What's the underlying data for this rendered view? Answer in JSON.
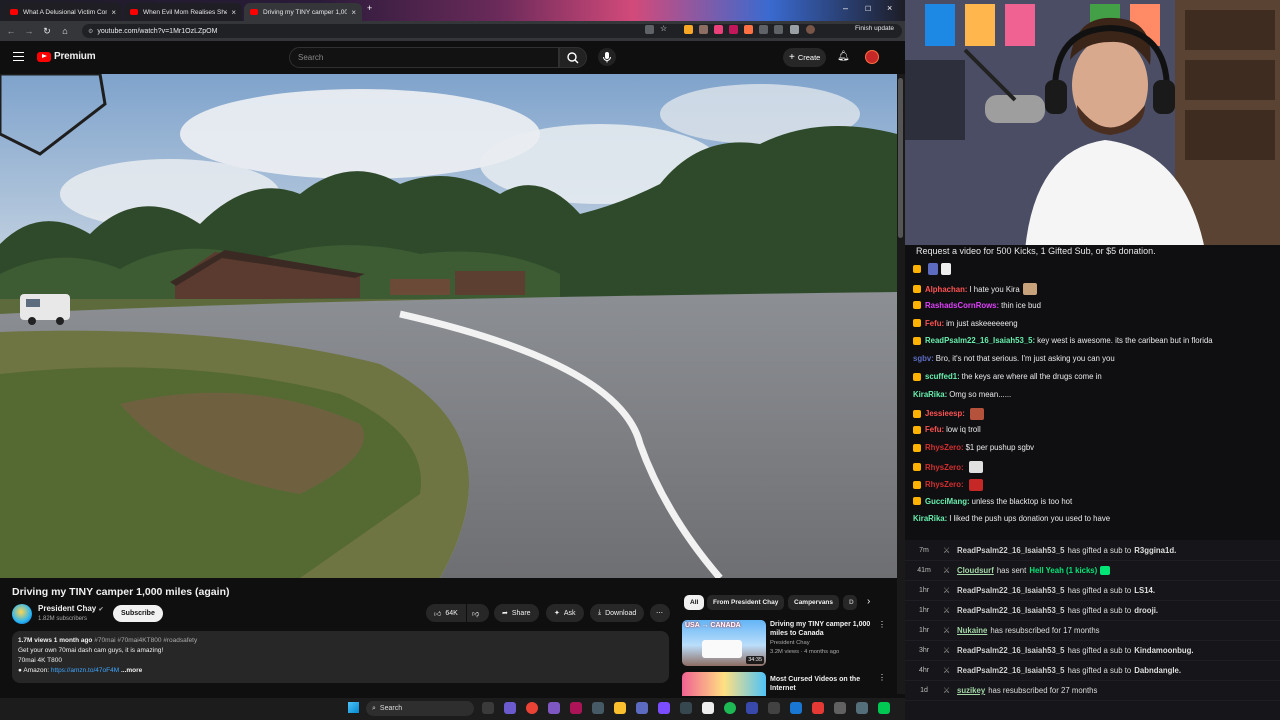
{
  "browser": {
    "tabs": [
      {
        "title": "What A Delusional Victim Com..."
      },
      {
        "title": "When Evil Mom Realises She's..."
      },
      {
        "title": "Driving my TINY camper 1,000 ..."
      }
    ],
    "url": "youtube.com/watch?v=1Mr1OzLZpOM",
    "finish_update": "Finish update"
  },
  "youtube": {
    "logo_text": "Premium",
    "search_placeholder": "Search",
    "create_label": "Create",
    "video": {
      "title": "Driving my TINY camper 1,000 miles (again)",
      "channel": "President Chay",
      "subscribers": "1.82M subscribers",
      "subscribe_label": "Subscribe",
      "likes": "64K",
      "share_label": "Share",
      "ask_label": "Ask",
      "download_label": "Download"
    },
    "description": {
      "meta": "1.7M views  1 month ago",
      "tags": "#70mai #70mai4KT800 #roadsafety",
      "line2": "Get your own 70mai dash cam guys, it is amazing!",
      "line3": "70mai 4K T800",
      "line4_prefix": "● Amazon: ",
      "line4_link": "https://amzn.to/47oF4M",
      "more": "...more"
    },
    "chips": [
      "All",
      "From President Chay",
      "Campervans",
      "D"
    ],
    "recommendations": [
      {
        "title": "Driving my TINY camper 1,000 miles to Canada",
        "channel": "President Chay",
        "views": "3.2M views · 4 months ago",
        "duration": "34:35",
        "thumb_text": "USA → CANADA"
      },
      {
        "title": "Most Cursed Videos on the Internet",
        "channel": "",
        "views": "",
        "duration": ""
      }
    ]
  },
  "stream": {
    "request_line": "Request a video for 500 Kicks, 1 Gifted Sub, or $5 donation.",
    "chat": [
      {
        "user": "Alphachan:",
        "msg": "I hate you Kira",
        "color": "#ff5252",
        "badge": "#ffb300",
        "emote": "#c8a27a"
      },
      {
        "user": "RashadsCornRows:",
        "msg": "thin ice bud",
        "color": "#e040fb",
        "badge": "#ffb300"
      },
      {
        "user": "Fefu:",
        "msg": "im just askeeeeeeng",
        "color": "#ff5252",
        "badge": "#ffb300"
      },
      {
        "user": "ReadPsalm22_16_Isaiah53_5:",
        "msg": "key west is awesome. its the caribean but in florida",
        "color": "#69f0ae",
        "badge": "#ffb300"
      },
      {
        "user": "sgbv:",
        "msg": "Bro, it's not that serious. I'm just asking you can you",
        "color": "#5c6bc0",
        "badge": ""
      },
      {
        "user": "scuffed1:",
        "msg": "the keys are where all the drugs come in",
        "color": "#69f0ae",
        "badge": "#ffb300"
      },
      {
        "user": "KiraRika:",
        "msg": "Omg so mean......",
        "color": "#69f0ae",
        "badge": ""
      },
      {
        "user": "Jessieesp:",
        "msg": "",
        "color": "#ff5252",
        "badge": "#ffb300",
        "emote": "#b5523b"
      },
      {
        "user": "Fefu:",
        "msg": "low iq troll",
        "color": "#ff5252",
        "badge": "#ffb300"
      },
      {
        "user": "RhysZero:",
        "msg": "$1 per pushup sgbv",
        "color": "#d32f2f",
        "badge": "#ffb300"
      },
      {
        "user": "RhysZero:",
        "msg": "",
        "color": "#d32f2f",
        "badge": "#ffb300",
        "emote": "#e0e0e0"
      },
      {
        "user": "RhysZero:",
        "msg": "",
        "color": "#d32f2f",
        "badge": "#ffb300",
        "emote": "#c62828"
      },
      {
        "user": "GucciMang:",
        "msg": "unless the blacktop is too hot",
        "color": "#69f0ae",
        "badge": "#ffb300"
      },
      {
        "user": "KiraRika:",
        "msg": "I liked the push ups donation you used to have",
        "color": "#69f0ae",
        "badge": ""
      }
    ],
    "events": [
      {
        "time": "7m",
        "user": "ReadPsalm22_16_Isaiah53_5",
        "action": "has gifted a sub to",
        "target": "R3ggina1d."
      },
      {
        "time": "41m",
        "user": "Cloudsurf",
        "action": "has sent",
        "target": "",
        "gift": "Hell Yeah (1 kicks)"
      },
      {
        "time": "1hr",
        "user": "ReadPsalm22_16_Isaiah53_5",
        "action": "has gifted a sub to",
        "target": "LS14."
      },
      {
        "time": "1hr",
        "user": "ReadPsalm22_16_Isaiah53_5",
        "action": "has gifted a sub to",
        "target": "drooji."
      },
      {
        "time": "1hr",
        "user": "Nukaine",
        "action": "has resubscribed for 17 months",
        "target": ""
      },
      {
        "time": "3hr",
        "user": "ReadPsalm22_16_Isaiah53_5",
        "action": "has gifted a sub to",
        "target": "Kindamoonbug."
      },
      {
        "time": "4hr",
        "user": "ReadPsalm22_16_Isaiah53_5",
        "action": "has gifted a sub to",
        "target": "Dabndangle."
      },
      {
        "time": "1d",
        "user": "suzikey",
        "action": "has resubscribed for 27 months",
        "target": ""
      }
    ]
  },
  "taskbar": {
    "search_label": "Search"
  },
  "colors": {
    "yt_red": "#ff0000",
    "accent_green": "#00e676",
    "bg": "#0f0f0f"
  }
}
